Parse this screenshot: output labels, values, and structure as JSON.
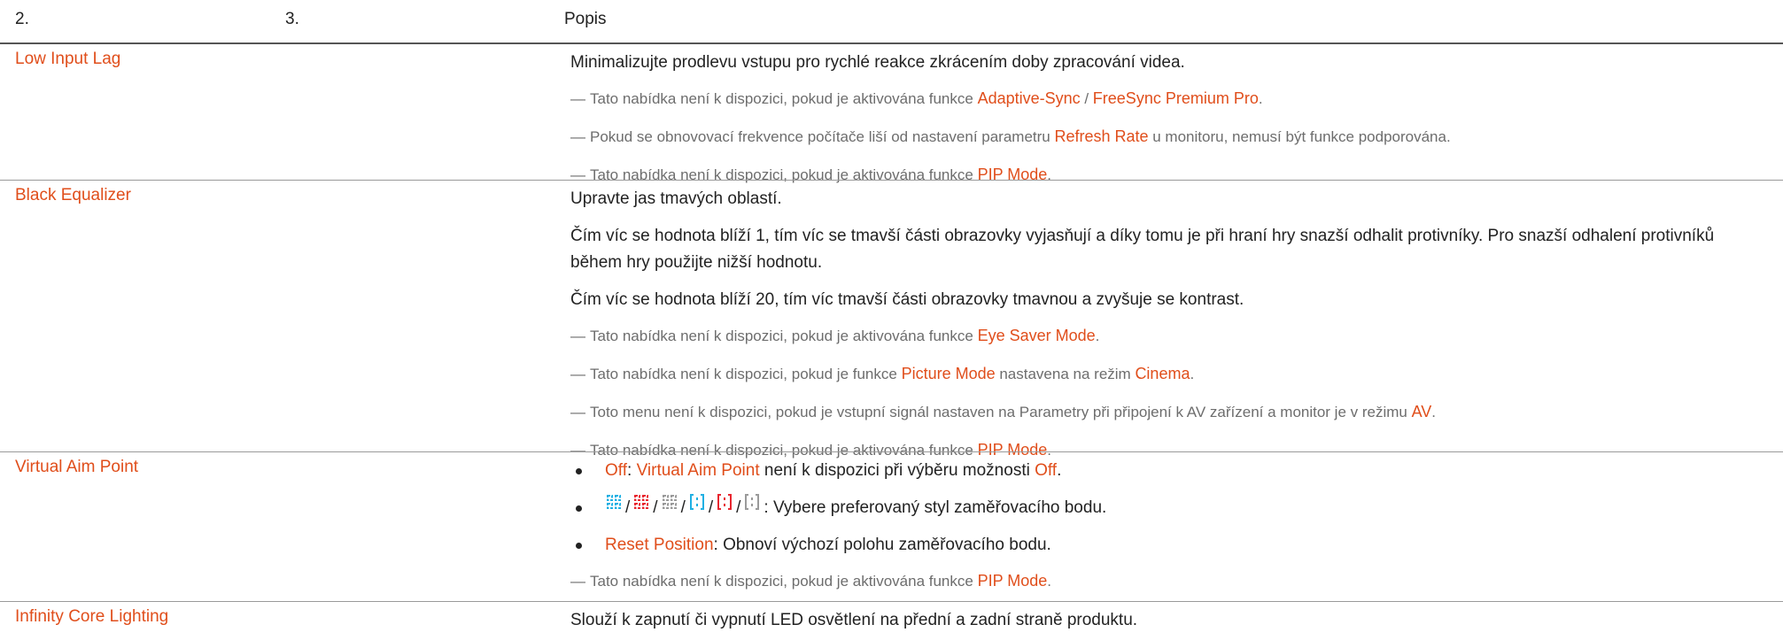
{
  "header": {
    "col_name": "2.",
    "col_sub": "3.",
    "col_desc": "Popis"
  },
  "rows": {
    "low_input_lag": {
      "name": "Low Input Lag",
      "desc": "Minimalizujte prodlevu vstupu pro rychlé reakce zkrácením doby zpracování videa.",
      "note1": {
        "a": "Tato nabídka není k dispozici, pokud je aktivována funkce ",
        "b": "Adaptive-Sync",
        "c": " / ",
        "d": "FreeSync Premium Pro",
        "e": "."
      },
      "note2": {
        "a": "Pokud se obnovovací frekvence počítače liší od nastavení parametru ",
        "b": "Refresh Rate",
        "c": " u monitoru, nemusí být funkce podporována."
      },
      "note3": {
        "a": "Tato nabídka není k dispozici, pokud je aktivována funkce ",
        "b": "PIP Mode",
        "c": "."
      }
    },
    "black_equalizer": {
      "name": "Black Equalizer",
      "desc1": "Upravte jas tmavých oblastí.",
      "desc2": "Čím víc se hodnota blíží 1, tím víc se tmavší části obrazovky vyjasňují a díky tomu je při hraní hry snazší odhalit protivníky. Pro snazší odhalení protivníků během hry použijte nižší hodnotu.",
      "desc3": "Čím víc se hodnota blíží 20, tím víc tmavší části obrazovky tmavnou a zvyšuje se kontrast.",
      "note1": {
        "a": "Tato nabídka není k dispozici, pokud je aktivována funkce ",
        "b": "Eye Saver Mode",
        "c": "."
      },
      "note2": {
        "a": "Tato nabídka není k dispozici, pokud je funkce ",
        "b": "Picture Mode",
        "c": " nastavena na režim ",
        "d": "Cinema",
        "e": "."
      },
      "note3": {
        "a": "Toto menu není k dispozici, pokud je vstupní signál nastaven na Parametry při připojení k AV zařízení a monitor je v režimu ",
        "b": "AV",
        "c": "."
      },
      "note4": {
        "a": "Tato nabídka není k dispozici, pokud je aktivována funkce ",
        "b": "PIP Mode",
        "c": "."
      }
    },
    "virtual_aim_point": {
      "name": "Virtual Aim Point",
      "bullet1": {
        "a": "Off",
        "b": ": ",
        "c": "Virtual Aim Point",
        "d": " není k dispozici při výběru možnosti ",
        "e": "Off",
        "f": "."
      },
      "bullet2": {
        "sep": "/",
        "text": ": Vybere preferovaný styl zaměřovacího bodu."
      },
      "bullet3": {
        "a": "Reset Position",
        "b": ": Obnoví výchozí polohu zaměřovacího bodu."
      },
      "note1": {
        "a": "Tato nabídka není k dispozici, pokud je aktivována funkce ",
        "b": "PIP Mode",
        "c": "."
      }
    },
    "infinity_core_lighting": {
      "name": "Infinity Core Lighting",
      "desc": "Slouží k zapnutí či vypnutí LED osvětlení na přední a zadní straně produktu."
    }
  },
  "note_mark": "―",
  "aim_icons": [
    {
      "name": "crosshair-square-cyan-icon",
      "color": "#1fb0e3"
    },
    {
      "name": "crosshair-square-red-icon",
      "color": "#e8262f"
    },
    {
      "name": "crosshair-square-gray-icon",
      "color": "#9a9a9a"
    },
    {
      "name": "crosshair-bracket-cyan-icon",
      "color": "#1fb0e3"
    },
    {
      "name": "crosshair-bracket-red-icon",
      "color": "#e8262f"
    },
    {
      "name": "crosshair-bracket-gray-icon",
      "color": "#9a9a9a"
    }
  ],
  "colors": {
    "accent": "#e04e1b",
    "note_text": "#6d6d6d",
    "rule": "#9a9a9a"
  }
}
